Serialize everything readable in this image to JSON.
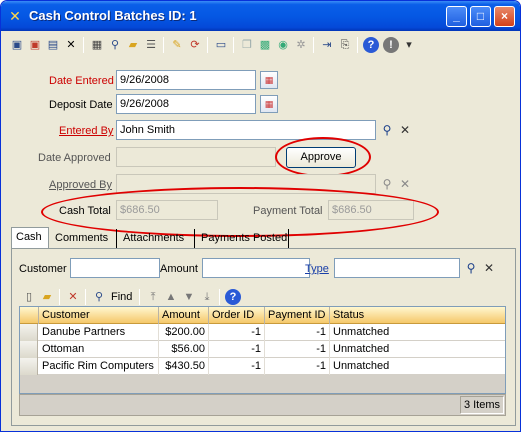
{
  "window": {
    "title": "Cash Control Batches ID: 1",
    "title_icon": "app-icon",
    "controls": {
      "minimize": "_",
      "maximize": "□",
      "close": "×"
    }
  },
  "toolbar": {
    "icons": [
      "save-icon",
      "save-close-icon",
      "save-new-icon",
      "delete-icon",
      "print-icon",
      "find-icon",
      "open-folder-icon",
      "properties-icon",
      "spell-check-icon",
      "refresh-icon",
      "reports-icon",
      "copy-icon",
      "paste-icon",
      "post-icon",
      "settings-icon",
      "import-icon",
      "attach-icon",
      "help-icon",
      "info-icon"
    ]
  },
  "form": {
    "date_entered": {
      "label": "Date Entered",
      "value": "9/26/2008"
    },
    "deposit_date": {
      "label": "Deposit Date",
      "value": "9/26/2008"
    },
    "entered_by": {
      "label": "Entered By",
      "value": "John Smith"
    },
    "date_approved": {
      "label": "Date Approved",
      "value": ""
    },
    "approve_button": "Approve",
    "approved_by": {
      "label": "Approved By",
      "value": ""
    },
    "cash_total": {
      "label": "Cash Total",
      "value": "$686.50"
    },
    "payment_total": {
      "label": "Payment Total",
      "value": "$686.50"
    }
  },
  "tabs": [
    {
      "label": "Cash",
      "active": true
    },
    {
      "label": "Comments",
      "active": false
    },
    {
      "label": "Attachments",
      "active": false
    },
    {
      "label": "Payments Posted",
      "active": false
    }
  ],
  "cash_tab": {
    "filter": {
      "customer_label": "Customer",
      "customer_value": "",
      "amount_label": "Amount",
      "amount_value": "",
      "type_label": "Type",
      "type_value": ""
    },
    "grid_toolbar": {
      "find_label": "Find"
    },
    "columns": [
      "Customer",
      "Amount",
      "Order ID",
      "Payment ID",
      "Status"
    ],
    "rows": [
      {
        "customer": "Danube Partners",
        "amount": "$200.00",
        "order_id": "-1",
        "payment_id": "-1",
        "status": "Unmatched"
      },
      {
        "customer": "Ottoman",
        "amount": "$56.00",
        "order_id": "-1",
        "payment_id": "-1",
        "status": "Unmatched"
      },
      {
        "customer": "Pacific Rim Computers",
        "amount": "$430.50",
        "order_id": "-1",
        "payment_id": "-1",
        "status": "Unmatched"
      }
    ],
    "status_count": "3 Items"
  },
  "colors": {
    "title_bar": "#0558e4",
    "required_label": "#cc0000",
    "annotation_circle": "#e00000",
    "grid_header": "#f5c86a"
  }
}
